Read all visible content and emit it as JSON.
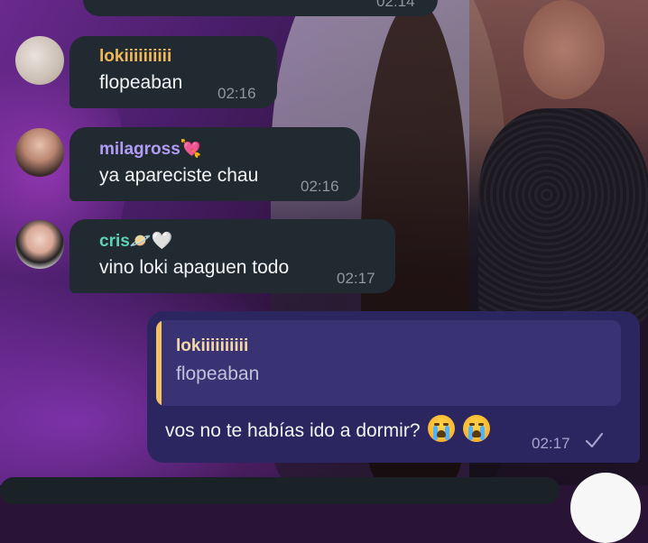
{
  "top_partial": {
    "time": "02:14"
  },
  "messages": [
    {
      "sender": "lokiiiiiiiiii",
      "sender_color": "#f0b858",
      "text": "flopeaban",
      "time": "02:16",
      "avatar_icon": "user-photo"
    },
    {
      "sender": "milagross💘",
      "sender_color": "#b29cf5",
      "text": "ya apareciste chau",
      "time": "02:16",
      "avatar_icon": "user-photo"
    },
    {
      "sender": "cris🪐🤍",
      "sender_color": "#5ed3b4",
      "text": "vino loki apaguen todo",
      "time": "02:17",
      "avatar_icon": "user-photo"
    }
  ],
  "outgoing": {
    "reply_to": {
      "sender": "lokiiiiiiiiii",
      "text": "flopeaban"
    },
    "text": "vos no te habías ido a dormir?",
    "emoji": "loudly-crying-face",
    "emoji_count": 2,
    "time": "02:17",
    "status_icon": "check-icon"
  },
  "colors": {
    "incoming_bubble": "#212a31",
    "outgoing_bubble": "#2c2660",
    "reply_bar": "#f3c263"
  }
}
